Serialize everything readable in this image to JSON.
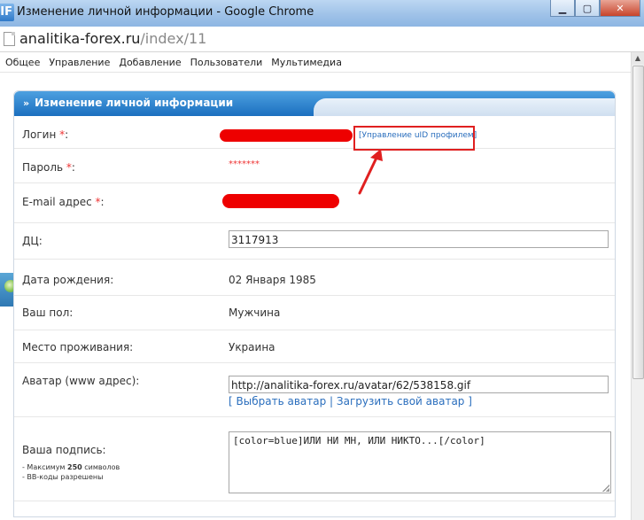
{
  "window": {
    "title": "Изменение личной информации - Google Chrome",
    "icon_label": "IF"
  },
  "address": {
    "host": "analitika-forex.ru",
    "path": "/index/11"
  },
  "nav": {
    "items": [
      "Общее",
      "Управление",
      "Добавление",
      "Пользователи",
      "Мультимедиа"
    ]
  },
  "panel": {
    "title": "Изменение личной информации"
  },
  "form": {
    "login_label": "Логин",
    "password_label": "Пароль",
    "password_value": "*******",
    "email_label": "E-mail адрес",
    "required_mark": "*",
    "label_colon": ":",
    "uid_link": "[Управление uID профилем]",
    "dc_label": "ДЦ:",
    "dc_value": "3117913",
    "birth_label": "Дата рождения:",
    "birth_value": "02 Января 1985",
    "gender_label": "Ваш пол:",
    "gender_value": "Мужчина",
    "residence_label": "Место проживания:",
    "residence_value": "Украина",
    "avatar_label": "Аватар (www адрес):",
    "avatar_value": "http://analitika-forex.ru/avatar/62/538158.gif",
    "avatar_open": "[",
    "avatar_choose": "Выбрать аватар",
    "avatar_sep": "|",
    "avatar_upload": "Загрузить свой аватар",
    "avatar_close": "]",
    "signature_label": "Ваша подпись:",
    "signature_note_prefix": "- Максимум ",
    "signature_note_max": "250",
    "signature_note_suffix": " символов",
    "signature_note2": "- BB-коды разрешены",
    "signature_value": "[color=blue]ИЛИ НИ МН, ИЛИ НИКТО...[/color]"
  },
  "colors": {
    "header_blue": "#1b6fbf",
    "link_blue": "#2a6ebd",
    "annotation_red": "#e02020"
  },
  "icons": {
    "window_min": "minimize-icon",
    "window_max": "maximize-icon",
    "window_close": "close-icon"
  }
}
